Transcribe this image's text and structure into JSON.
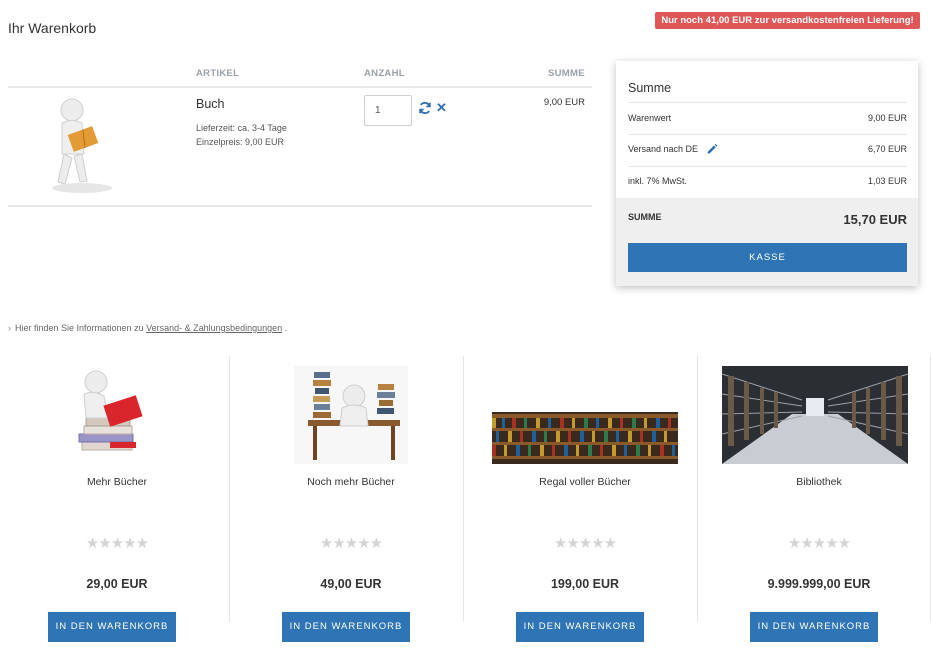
{
  "cart": {
    "title": "Ihr Warenkorb",
    "free_shipping_notice": "Nur noch 41,00 EUR zur versandkostenfreien Lieferung!",
    "columns": {
      "article": "ARTIKEL",
      "quantity": "ANZAHL",
      "sum": "SUMME"
    },
    "item": {
      "name": "Buch",
      "delivery": "Lieferzeit: ca. 3-4 Tage",
      "unit_price": "Einzelpreis: 9,00 EUR",
      "quantity": "1",
      "line_total": "9,00 EUR",
      "image_icon": "person-reading-book-image"
    }
  },
  "summary": {
    "title": "Summe",
    "rows": [
      {
        "label": "Warenwert",
        "value": "9,00 EUR"
      },
      {
        "label": "Versand nach DE",
        "value": "6,70 EUR"
      },
      {
        "label": "inkl. 7% MwSt.",
        "value": "1,03 EUR"
      }
    ],
    "total_label": "SUMME",
    "total_value": "15,70 EUR",
    "checkout_label": "KASSE"
  },
  "info": {
    "prefix": "Hier finden Sie Informationen zu",
    "link": "Versand- & Zahlungsbedingungen",
    "suffix": "."
  },
  "recommendations": [
    {
      "name": "Mehr Bücher",
      "price": "29,00 EUR",
      "stars": "★★★★★",
      "button": "IN DEN WARENKORB",
      "image_icon": "person-with-books-image"
    },
    {
      "name": "Noch mehr Bücher",
      "price": "49,00 EUR",
      "stars": "★★★★★",
      "button": "IN DEN WARENKORB",
      "image_icon": "person-at-desk-books-image"
    },
    {
      "name": "Regal voller Bücher",
      "price": "199,00 EUR",
      "stars": "★★★★★",
      "button": "IN DEN WARENKORB",
      "image_icon": "bookshelf-image"
    },
    {
      "name": "Bibliothek",
      "price": "9.999.999,00 EUR",
      "stars": "★★★★★",
      "button": "IN DEN WARENKORB",
      "image_icon": "library-aisle-image"
    }
  ],
  "colors": {
    "primary_button": "#2f75b5",
    "notice_red": "#e05757",
    "link_blue": "#2e6fae",
    "star_grey": "#d4d4d4"
  }
}
